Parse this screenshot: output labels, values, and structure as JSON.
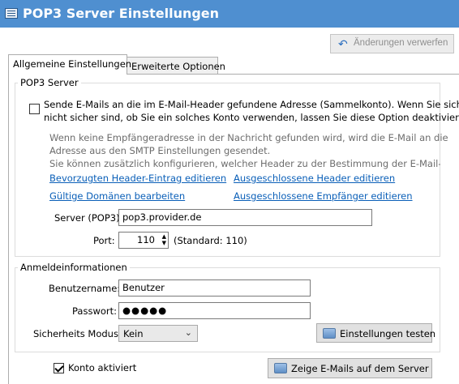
{
  "window": {
    "title": "POP3 Server Einstellungen"
  },
  "toolbar": {
    "discard_label": "Änderungen verwerfen",
    "discard_icon": "undo-arrow-icon"
  },
  "tabs": [
    {
      "label": "Allgemeine Einstellungen",
      "active": true
    },
    {
      "label": "Erweiterte Optionen",
      "active": false
    }
  ],
  "pop3_group": {
    "legend": "POP3 Server",
    "catchall_checkbox": {
      "checked": false,
      "line1": "Sende E-Mails an die im E-Mail-Header gefundene Adresse (Sammelkonto). Wenn Sie sich",
      "line2": "nicht sicher sind, ob Sie ein solches Konto verwenden, lassen Sie diese Option deaktiviert."
    },
    "description": {
      "line1": "Wenn keine Empfängeradresse in der Nachricht gefunden wird, wird die E-Mail an die",
      "line2": "Adresse aus den SMTP Einstellungen gesendet.",
      "line3": "Sie können zusätzlich konfigurieren, welcher Header zu der Bestimmung der E-Mail-Adresse"
    },
    "links": {
      "preferred_header": "Bevorzugten Header-Eintrag editieren",
      "excluded_headers": "Ausgeschlossene Header editieren",
      "valid_domains": "Gültige Domänen bearbeiten",
      "excluded_recipients": "Ausgeschlossene Empfänger editieren"
    },
    "server_label": "Server (POP3):",
    "server_value": "pop3.provider.de",
    "port_label": "Port:",
    "port_value": "110",
    "port_hint": "(Standard: 110)"
  },
  "login_group": {
    "legend": "Anmeldeinformationen",
    "username_label": "Benutzername:",
    "username_value": "Benutzer",
    "password_label": "Passwort:",
    "password_value": "●●●●●",
    "security_label": "Sicherheits Modus:",
    "security_value": "Kein",
    "test_button": "Einstellungen testen"
  },
  "footer": {
    "account_active_label": "Konto aktiviert",
    "account_active_checked": true,
    "show_mails_button": "Zeige E-Mails auf dem Server"
  },
  "colors": {
    "titlebar": "#4f8fd0",
    "link": "#0a5fb8"
  }
}
